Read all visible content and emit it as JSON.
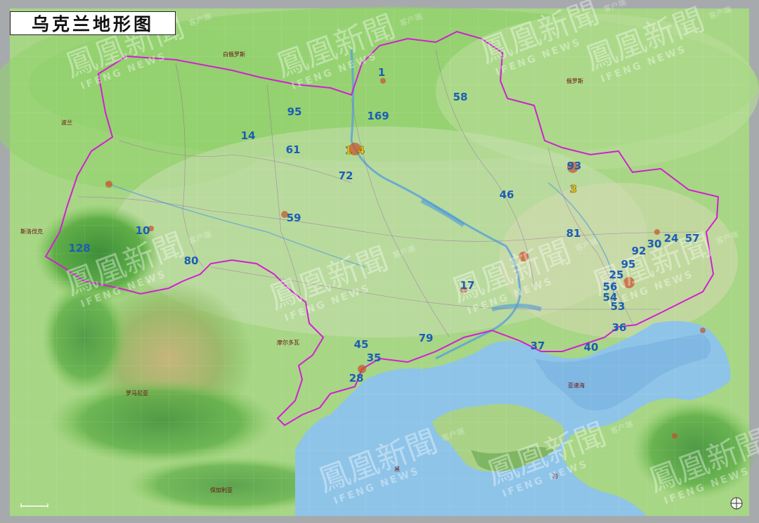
{
  "title": "乌克兰地形图",
  "colors": {
    "border": "#d21fd2",
    "number_blue": "#1c5db4",
    "number_yellow": "#f2d226",
    "sea": "#8ec4e8",
    "land_green": "#8fcf6a"
  },
  "place_labels": [
    {
      "id": "belarus",
      "text": "白俄罗斯"
    },
    {
      "id": "russia",
      "text": "俄罗斯"
    },
    {
      "id": "poland",
      "text": "波兰"
    },
    {
      "id": "romania",
      "text": "罗马尼亚"
    },
    {
      "id": "moldova",
      "text": "摩尔多瓦"
    },
    {
      "id": "bulgaria",
      "text": "保加利亚"
    },
    {
      "id": "azov",
      "text": "亚速海"
    },
    {
      "id": "black",
      "text": "黑"
    },
    {
      "id": "sea",
      "text": "海"
    },
    {
      "id": "slovakia",
      "text": "斯洛伐克"
    }
  ],
  "markers": [
    {
      "text": "1",
      "color": "blue"
    },
    {
      "text": "58",
      "color": "blue"
    },
    {
      "text": "169",
      "color": "blue"
    },
    {
      "text": "95",
      "color": "blue"
    },
    {
      "text": "14",
      "color": "blue"
    },
    {
      "text": "61",
      "color": "blue"
    },
    {
      "text": "1",
      "color": "yellow"
    },
    {
      "text": "4",
      "color": "yellow"
    },
    {
      "text": "72",
      "color": "blue"
    },
    {
      "text": "93",
      "color": "blue"
    },
    {
      "text": "3",
      "color": "yellow"
    },
    {
      "text": "46",
      "color": "blue"
    },
    {
      "text": "59",
      "color": "blue"
    },
    {
      "text": "10",
      "color": "blue"
    },
    {
      "text": "128",
      "color": "blue"
    },
    {
      "text": "81",
      "color": "blue"
    },
    {
      "text": "30",
      "color": "blue"
    },
    {
      "text": "24",
      "color": "blue"
    },
    {
      "text": "57",
      "color": "blue"
    },
    {
      "text": "92",
      "color": "blue"
    },
    {
      "text": "95",
      "color": "blue"
    },
    {
      "text": "80",
      "color": "blue"
    },
    {
      "text": "25",
      "color": "blue"
    },
    {
      "text": "56",
      "color": "blue"
    },
    {
      "text": "54",
      "color": "blue"
    },
    {
      "text": "53",
      "color": "blue"
    },
    {
      "text": "17",
      "color": "blue"
    },
    {
      "text": "36",
      "color": "blue"
    },
    {
      "text": "79",
      "color": "blue"
    },
    {
      "text": "45",
      "color": "blue"
    },
    {
      "text": "35",
      "color": "blue"
    },
    {
      "text": "37",
      "color": "blue"
    },
    {
      "text": "40",
      "color": "blue"
    },
    {
      "text": "28",
      "color": "blue"
    }
  ],
  "watermark": {
    "cn": "鳳凰新聞",
    "en": "IFENG NEWS",
    "side": "客户端"
  },
  "icons": {
    "compass": "compass-icon",
    "scale": "scale-bar"
  }
}
